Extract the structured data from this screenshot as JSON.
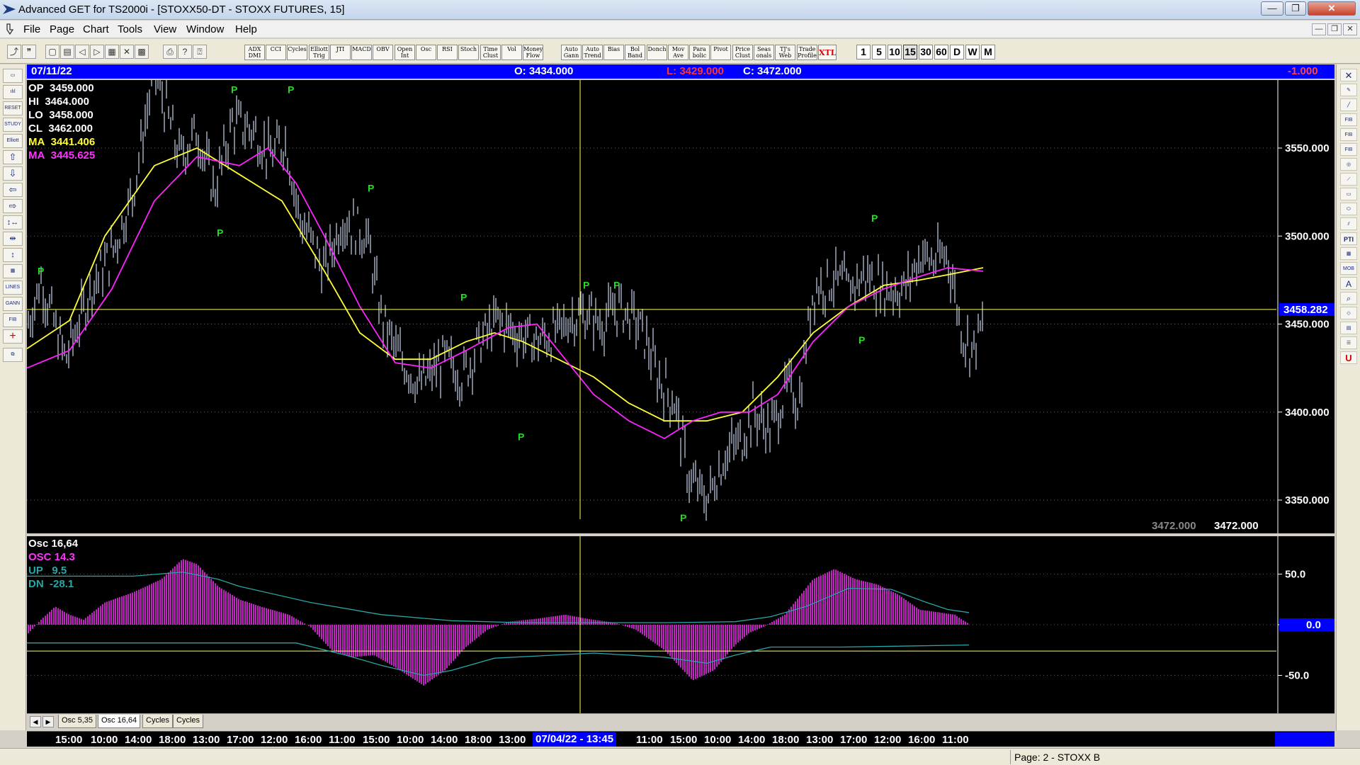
{
  "window": {
    "title": "Advanced GET for TS2000i - [STOXX50-DT - STOXX FUTURES, 15]",
    "controls": [
      "—",
      "❐",
      "✕"
    ],
    "mdi_controls": [
      "—",
      "❐",
      "✕"
    ]
  },
  "menu": [
    "File",
    "Page",
    "Chart",
    "Tools",
    "View",
    "Window",
    "Help"
  ],
  "toolbar": {
    "studies": [
      {
        "name": "adx-dmi",
        "label": "ADX DMI"
      },
      {
        "name": "cci",
        "label": "CCI"
      },
      {
        "name": "cycles",
        "label": "Cycles"
      },
      {
        "name": "elliott-trig",
        "label": "Elliott Trig"
      },
      {
        "name": "jti",
        "label": "JTI"
      },
      {
        "name": "macd",
        "label": "MACD"
      },
      {
        "name": "obv",
        "label": "OBV"
      },
      {
        "name": "open-int",
        "label": "Open Int"
      },
      {
        "name": "osc",
        "label": "Osc"
      },
      {
        "name": "rsi",
        "label": "RSI"
      },
      {
        "name": "stoch",
        "label": "Stoch"
      },
      {
        "name": "time-clust",
        "label": "Time Clust"
      },
      {
        "name": "vol",
        "label": "Vol"
      },
      {
        "name": "money-flow",
        "label": "Money Flow"
      },
      {
        "name": "auto-gann",
        "label": "Auto Gann"
      },
      {
        "name": "auto-trend",
        "label": "Auto Trend"
      },
      {
        "name": "bias",
        "label": "Bias"
      },
      {
        "name": "bol-band",
        "label": "Bol Band"
      },
      {
        "name": "donch",
        "label": "Donch"
      },
      {
        "name": "mov-ave",
        "label": "Mov Ave"
      },
      {
        "name": "para-bolic",
        "label": "Para bolic"
      },
      {
        "name": "pivot",
        "label": "Pivot"
      },
      {
        "name": "price-clust",
        "label": "Price Clust"
      },
      {
        "name": "seas-onals",
        "label": "Seas onals"
      },
      {
        "name": "tjs-web",
        "label": "TJ's Web"
      },
      {
        "name": "trade-profile",
        "label": "Trade Profile"
      },
      {
        "name": "xtl",
        "label": "XTL"
      }
    ],
    "timeframes": [
      "1",
      "5",
      "10",
      "15",
      "30",
      "60",
      "D",
      "W",
      "M"
    ],
    "active_timeframe": "15"
  },
  "infobar": {
    "date": "07/11/22",
    "open": "O: 3434.000",
    "low": "L: 3429.000",
    "close": "C: 3472.000",
    "change": "-1.000"
  },
  "readouts": {
    "op": {
      "label": "OP",
      "value": "3459.000"
    },
    "hi": {
      "label": "HI",
      "value": "3464.000"
    },
    "lo": {
      "label": "LO",
      "value": "3458.000"
    },
    "cl": {
      "label": "CL",
      "value": "3462.000"
    },
    "ma1": {
      "label": "MA",
      "value": "3441.406"
    },
    "ma2": {
      "label": "MA",
      "value": "3445.625"
    }
  },
  "osc_readouts": {
    "title": "Osc 16,64",
    "osc": {
      "label": "OSC",
      "value": "14.3"
    },
    "up": {
      "label": "UP",
      "value": "9.5"
    },
    "dn": {
      "label": "DN",
      "value": "-28.1"
    }
  },
  "price_axis": {
    "ticks": [
      "3550.000",
      "3500.000",
      "3450.000",
      "3400.000",
      "3350.000"
    ],
    "current_price_label": "3458.282",
    "bottom_labels": [
      "3472.000",
      "3472.000"
    ]
  },
  "osc_axis": {
    "ticks": [
      "50.0",
      "0.0",
      "-50.0"
    ]
  },
  "tabs": [
    "Osc 5,35",
    "Osc 16,64",
    "Cycles",
    "Cycles"
  ],
  "active_tab": 1,
  "time_axis": {
    "labels": [
      "15:00",
      "10:00",
      "14:00",
      "18:00",
      "13:00",
      "17:00",
      "12:00",
      "16:00",
      "11:00",
      "15:00",
      "10:00",
      "14:00",
      "18:00",
      "13:00",
      "11:00",
      "15:00",
      "10:00",
      "14:00",
      "18:00",
      "13:00",
      "17:00",
      "12:00",
      "16:00",
      "11:00"
    ],
    "cursor_label": "07/04/22 - 13:45"
  },
  "pivot_label": "P",
  "status": "Page: 2 - STOXX B",
  "colors": {
    "price_bars": "#c8d4ec",
    "ma_fast": "#ffff33",
    "ma_slow": "#ff22ff",
    "pivot": "#22dd22",
    "osc_bars": "#ff33ff",
    "band_line": "#2aa6a6",
    "crosshair": "#ffff66",
    "info_bg": "#0000ff"
  }
}
